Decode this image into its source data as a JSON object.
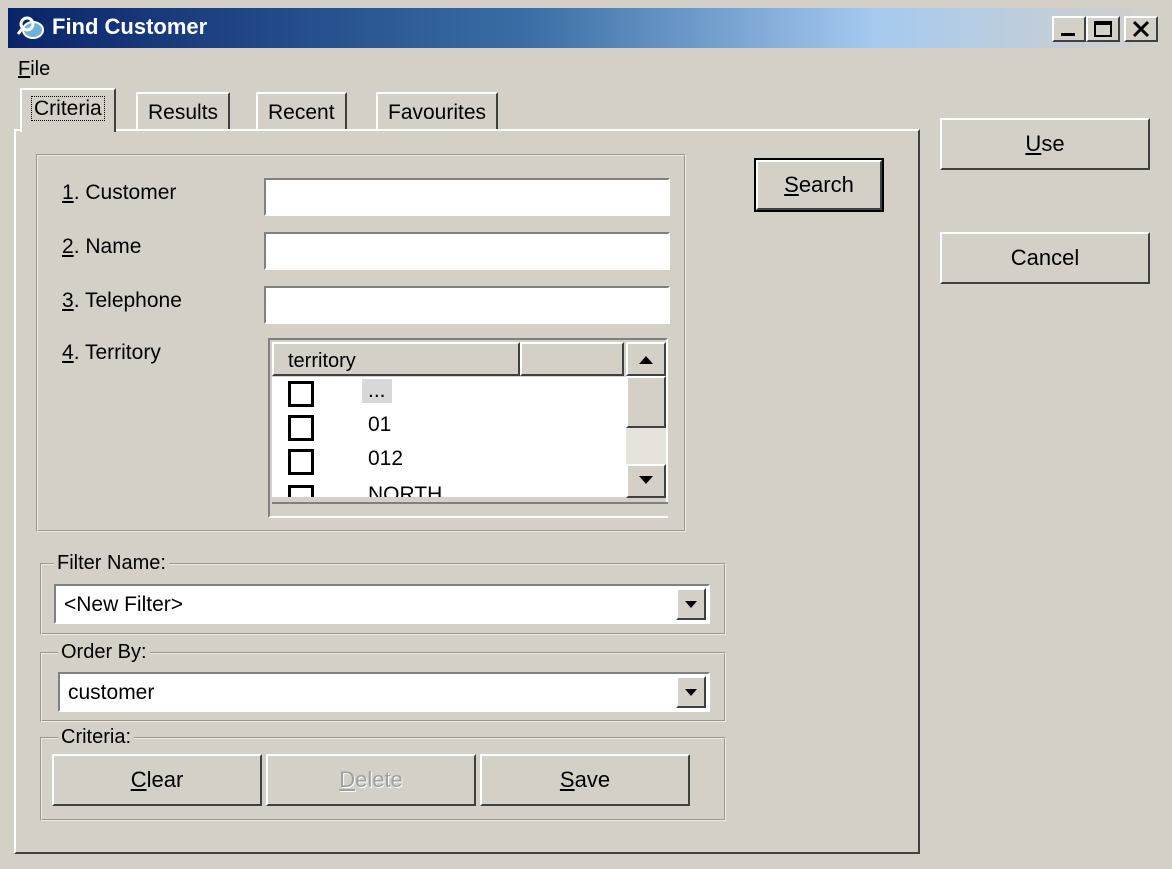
{
  "window": {
    "title": "Find Customer"
  },
  "menu": {
    "file": "File"
  },
  "tabs": [
    {
      "label": "Criteria",
      "active": true
    },
    {
      "label": "Results"
    },
    {
      "label": "Recent"
    },
    {
      "label": "Favourites"
    }
  ],
  "fields": {
    "customer_label": "1. Customer",
    "name_label": "2. Name",
    "telephone_label": "3. Telephone",
    "territory_label": "4. Territory",
    "customer_value": "",
    "name_value": "",
    "telephone_value": ""
  },
  "search_button": "Search",
  "territory_grid": {
    "header": "territory",
    "rows": [
      "...",
      "01",
      "012",
      "NORTH"
    ]
  },
  "filter": {
    "legend": "Filter Name:",
    "value": "<New Filter>"
  },
  "order_by": {
    "legend": "Order By:",
    "value": "customer"
  },
  "criteria": {
    "legend": "Criteria:",
    "clear": "Clear",
    "delete": "Delete",
    "save": "Save"
  },
  "side_buttons": {
    "use": "Use",
    "cancel": "Cancel"
  }
}
